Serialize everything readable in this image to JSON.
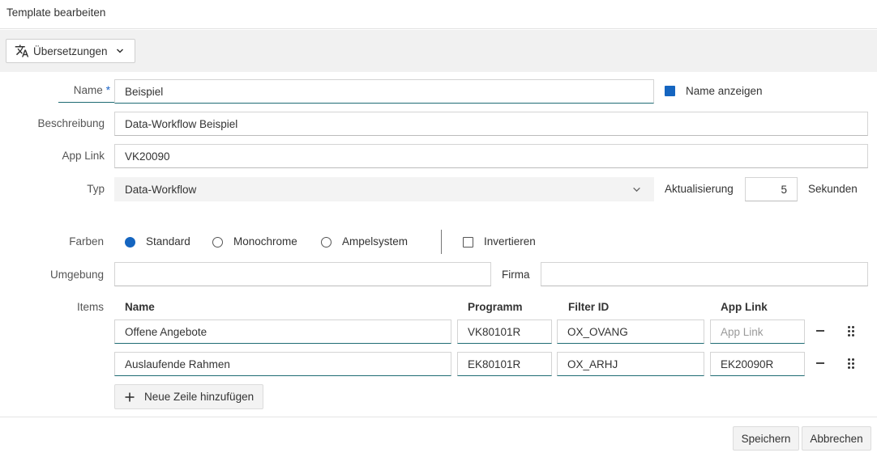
{
  "window": {
    "title": "Template bearbeiten"
  },
  "toolbar": {
    "translations_label": "Übersetzungen",
    "translate_icon": "translate-icon",
    "chevron_icon": "chevron-down-icon"
  },
  "form": {
    "name": {
      "label": "Name",
      "required_mark": "*",
      "value": "Beispiel"
    },
    "show_name": {
      "label": "Name anzeigen",
      "checked": true
    },
    "description": {
      "label": "Beschreibung",
      "value": "Data-Workflow Beispiel"
    },
    "app_link": {
      "label": "App Link",
      "value": "VK20090"
    },
    "type": {
      "label": "Typ",
      "value": "Data-Workflow"
    },
    "refresh": {
      "label": "Aktualisierung",
      "value": "5",
      "unit": "Sekunden"
    },
    "colors": {
      "label": "Farben",
      "options": [
        "Standard",
        "Monochrome",
        "Ampelsystem"
      ],
      "selected": "Standard",
      "invert_label": "Invertieren",
      "invert_checked": false
    },
    "environment": {
      "label": "Umgebung",
      "value": ""
    },
    "company": {
      "label": "Firma",
      "value": ""
    }
  },
  "items": {
    "label": "Items",
    "columns": [
      "Name",
      "Programm",
      "Filter ID",
      "App Link"
    ],
    "rows": [
      {
        "name": "Offene Angebote",
        "program": "VK80101R",
        "filter_id": "OX_OVANG",
        "app_link": "",
        "app_link_placeholder": "App Link"
      },
      {
        "name": "Auslaufende Rahmen",
        "program": "EK80101R",
        "filter_id": "OX_ARHJ",
        "app_link": "EK20090R",
        "app_link_placeholder": "App Link"
      }
    ],
    "add_row_label": "Neue Zeile hinzufügen"
  },
  "footer": {
    "save_label": "Speichern",
    "cancel_label": "Abbrechen"
  },
  "colors_theme": {
    "accent": "#1565c0",
    "underline": "#1f6c74",
    "toolbar_bg": "#f1f1f1"
  }
}
